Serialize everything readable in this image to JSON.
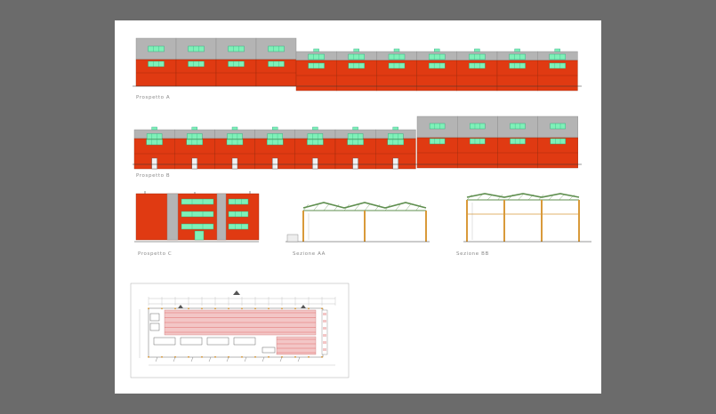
{
  "sheet": {
    "views": [
      {
        "id": "prospetto_a",
        "label": "Prospetto A"
      },
      {
        "id": "prospetto_b",
        "label": "Prospetto B"
      },
      {
        "id": "prospetto_c",
        "label": "Prospetto C"
      },
      {
        "id": "sezione_aa",
        "label": "Sezione AA"
      },
      {
        "id": "sezione_bb",
        "label": "Sezione BB"
      },
      {
        "id": "pianta",
        "label": ""
      }
    ]
  },
  "colors": {
    "background": "#6b6b6b",
    "sheet": "#ffffff",
    "facade_red": "#e03a12",
    "panel_grey": "#b4b4b4",
    "window_green": "#7ff0b8",
    "line_dark": "#333333",
    "roof_green": "#5f8f4f",
    "column_orange": "#d99a3a",
    "plan_pink": "#f3c6c6"
  },
  "icons": [
    "section-cut-marker-icon",
    "north-arrow-icon"
  ]
}
